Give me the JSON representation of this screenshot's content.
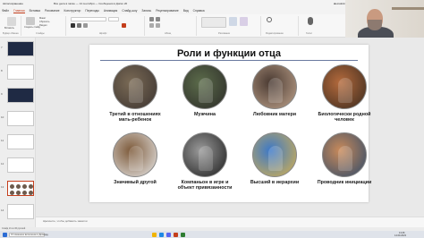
{
  "app": {
    "autosave_label": "Автосохранение",
    "file_title": "Все дела в папке — 14 сентября — Сообщения в Диско 20",
    "user_name": "alexsolvin"
  },
  "menu": {
    "items": [
      "Файл",
      "Главная",
      "Вставка",
      "Рисование",
      "Конструктор",
      "Переходы",
      "Анимация",
      "Слайд-шоу",
      "Запись",
      "Рецензирование",
      "Вид",
      "Справка"
    ],
    "active_index": 1
  },
  "ribbon": {
    "paste_label": "Вставить",
    "new_slide_label": "Создать слайд",
    "layout_label": "Макет",
    "reset_label": "Сбросить",
    "section_label": "Раздел",
    "clipboard_group": "Буфер обмена",
    "slides_group": "Слайды",
    "font_group": "Шрифт",
    "paragraph_group": "Абзац",
    "drawing_group": "Рисование",
    "editing_group": "Редактирование",
    "voice_group": "Голос"
  },
  "webcam": {
    "name_tag": "Alexander Solovev"
  },
  "thumbnails": [
    {
      "num": "7"
    },
    {
      "num": "8"
    },
    {
      "num": "9"
    },
    {
      "num": "10"
    },
    {
      "num": "11"
    },
    {
      "num": "12"
    },
    {
      "num": "13"
    },
    {
      "num": "14"
    }
  ],
  "slide": {
    "title": "Роли и функции отца",
    "items": [
      {
        "caption": "Третий в отношениях мать-ребенок",
        "icon": "family-photo"
      },
      {
        "caption": "Мужчина",
        "icon": "soldier-photo"
      },
      {
        "caption": "Любовник матери",
        "icon": "couple-photo"
      },
      {
        "caption": "Биологически родной человек",
        "icon": "cartoon-photo"
      },
      {
        "caption": "Значимый другой",
        "icon": "panda-photo"
      },
      {
        "caption": "Компаньон в игре и объект привязанности",
        "icon": "vader-photo"
      },
      {
        "caption": "Высший в иерархии",
        "icon": "king-photo"
      },
      {
        "caption": "Проводник инициации",
        "icon": "gnome-photo"
      }
    ]
  },
  "notes": {
    "placeholder": "Щелкните, чтобы добавить заметки"
  },
  "statusbar": {
    "text": "Слайд 13 из 36  русский"
  },
  "taskbar": {
    "search_text": "Отложенное включение в Дискорд",
    "time": "13:46",
    "date": "14.09.2023"
  },
  "colors": {
    "accent": "#c43e1c",
    "slide_rule": "#6a7aa0"
  }
}
